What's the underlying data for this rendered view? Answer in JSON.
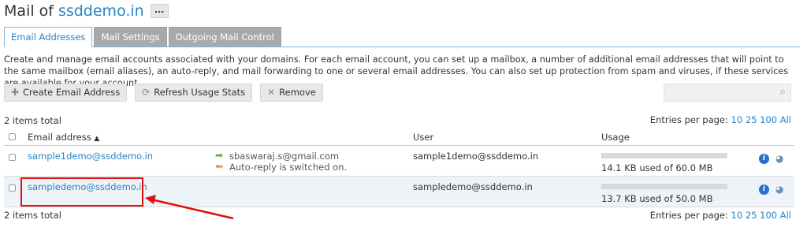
{
  "header": {
    "prefix": "Mail of",
    "domain": "ssddemo.in",
    "more_label": "..."
  },
  "tabs": [
    {
      "label": "Email Addresses",
      "active": true
    },
    {
      "label": "Mail Settings",
      "active": false
    },
    {
      "label": "Outgoing Mail Control",
      "active": false
    }
  ],
  "description": "Create and manage email accounts associated with your domains. For each email account, you can set up a mailbox, a number of additional email addresses that will point to the same mailbox (email aliases), an auto-reply, and mail forwarding to one or several email addresses. You can also set up protection from spam and viruses, if these services are available for your account.",
  "toolbar": {
    "create_label": "Create Email Address",
    "refresh_label": "Refresh Usage Stats",
    "remove_label": "Remove"
  },
  "search": {
    "placeholder": ""
  },
  "list": {
    "count": "2 items total",
    "per_page_label": "Entries per page:",
    "per_page_options": [
      "10",
      "25",
      "100",
      "All"
    ],
    "columns": {
      "email": "Email address",
      "user": "User",
      "usage": "Usage"
    },
    "rows": [
      {
        "email": "sample1demo@ssddemo.in",
        "forward": "sbaswaraj.s@gmail.com",
        "autoreply": "Auto-reply is switched on.",
        "user": "sample1demo@ssddemo.in",
        "usage": "14.1 KB used of 60.0 MB",
        "usage_fraction": 0.0002
      },
      {
        "email": "sampledemo@ssddemo.in",
        "forward": "",
        "autoreply": "",
        "user": "sampledemo@ssddemo.in",
        "usage": "13.7 KB used of 50.0 MB",
        "usage_fraction": 0.0003
      }
    ]
  },
  "colors": {
    "link": "#2684c8",
    "highlight": "#e01010",
    "tab_inactive": "#a9a9a9"
  }
}
